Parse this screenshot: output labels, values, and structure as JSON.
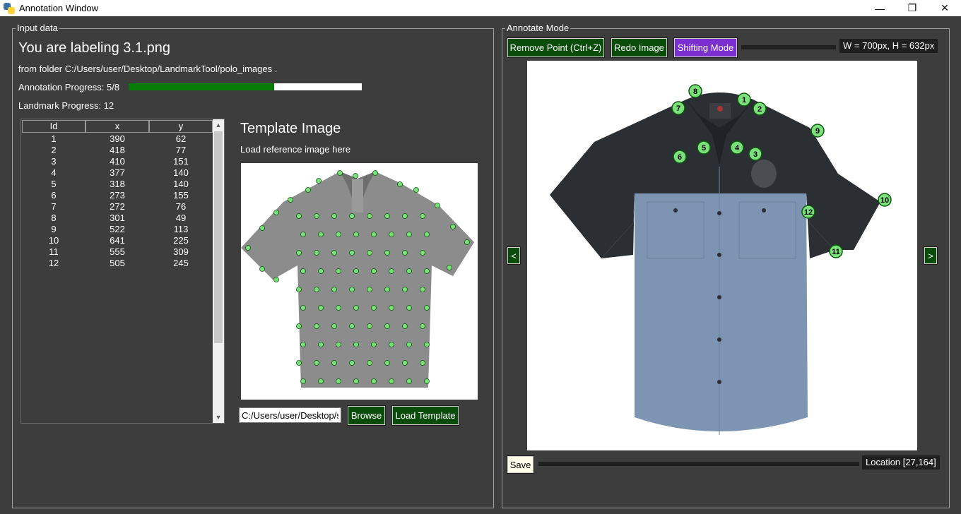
{
  "window": {
    "title": "Annotation Window",
    "minimize_glyph": "—",
    "maximize_glyph": "❐",
    "close_glyph": "✕"
  },
  "input_panel": {
    "frame_title": "Input data",
    "labeling_text": "You are labeling 3.1.png",
    "folder_text": "from folder C:/Users/user/Desktop/LandmarkTool/polo_images .",
    "annotation_progress_text": "Annotation Progress: 5/8",
    "annotation_progress_fraction": 0.625,
    "landmark_progress_text": "Landmark Progress: 12",
    "table": {
      "headers": [
        "Id",
        "x",
        "y"
      ],
      "rows": [
        [
          "1",
          "390",
          "62"
        ],
        [
          "2",
          "418",
          "77"
        ],
        [
          "3",
          "410",
          "151"
        ],
        [
          "4",
          "377",
          "140"
        ],
        [
          "5",
          "318",
          "140"
        ],
        [
          "6",
          "273",
          "155"
        ],
        [
          "7",
          "272",
          "76"
        ],
        [
          "8",
          "301",
          "49"
        ],
        [
          "9",
          "522",
          "113"
        ],
        [
          "10",
          "641",
          "225"
        ],
        [
          "11",
          "555",
          "309"
        ],
        [
          "12",
          "505",
          "245"
        ]
      ]
    },
    "template": {
      "title": "Template Image",
      "subtitle": "Load reference image here",
      "path_value": "C:/Users/user/Desktop/s",
      "browse_label": "Browse",
      "load_label": "Load Template"
    }
  },
  "annotate_panel": {
    "frame_title": "Annotate Mode",
    "remove_label": "Remove Point (Ctrl+Z)",
    "redo_label": "Redo Image",
    "shift_label": "Shifting Mode",
    "dimensions_text": "W = 700px, H = 632px",
    "prev_label": "<",
    "next_label": ">",
    "save_label": "Save",
    "location_text": "Location [27,164]",
    "accent_green": "#0a4d0a",
    "accent_purple": "#7b2fd1",
    "landmark_color": "#7be07b"
  }
}
